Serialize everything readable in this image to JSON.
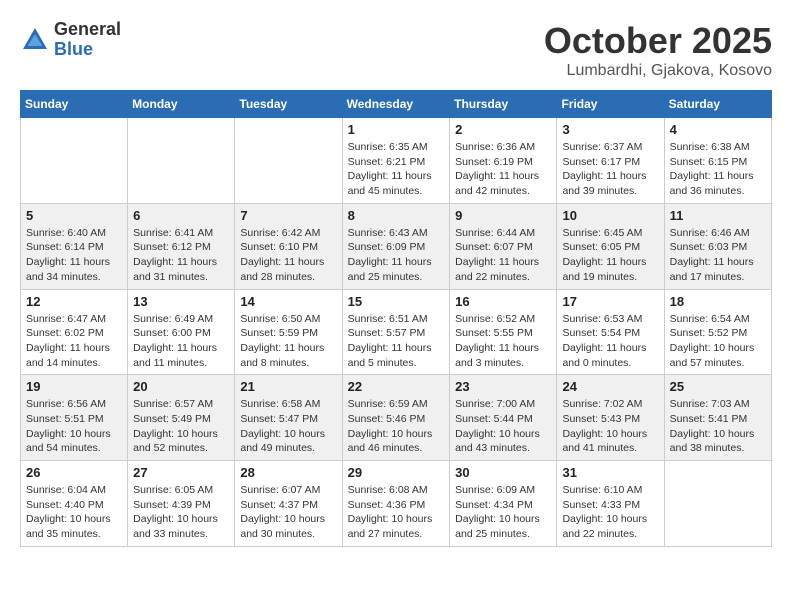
{
  "header": {
    "logo_general": "General",
    "logo_blue": "Blue",
    "month": "October 2025",
    "location": "Lumbardhi, Gjakova, Kosovo"
  },
  "weekdays": [
    "Sunday",
    "Monday",
    "Tuesday",
    "Wednesday",
    "Thursday",
    "Friday",
    "Saturday"
  ],
  "weeks": [
    [
      {
        "day": "",
        "info": ""
      },
      {
        "day": "",
        "info": ""
      },
      {
        "day": "",
        "info": ""
      },
      {
        "day": "1",
        "info": "Sunrise: 6:35 AM\nSunset: 6:21 PM\nDaylight: 11 hours and 45 minutes."
      },
      {
        "day": "2",
        "info": "Sunrise: 6:36 AM\nSunset: 6:19 PM\nDaylight: 11 hours and 42 minutes."
      },
      {
        "day": "3",
        "info": "Sunrise: 6:37 AM\nSunset: 6:17 PM\nDaylight: 11 hours and 39 minutes."
      },
      {
        "day": "4",
        "info": "Sunrise: 6:38 AM\nSunset: 6:15 PM\nDaylight: 11 hours and 36 minutes."
      }
    ],
    [
      {
        "day": "5",
        "info": "Sunrise: 6:40 AM\nSunset: 6:14 PM\nDaylight: 11 hours and 34 minutes."
      },
      {
        "day": "6",
        "info": "Sunrise: 6:41 AM\nSunset: 6:12 PM\nDaylight: 11 hours and 31 minutes."
      },
      {
        "day": "7",
        "info": "Sunrise: 6:42 AM\nSunset: 6:10 PM\nDaylight: 11 hours and 28 minutes."
      },
      {
        "day": "8",
        "info": "Sunrise: 6:43 AM\nSunset: 6:09 PM\nDaylight: 11 hours and 25 minutes."
      },
      {
        "day": "9",
        "info": "Sunrise: 6:44 AM\nSunset: 6:07 PM\nDaylight: 11 hours and 22 minutes."
      },
      {
        "day": "10",
        "info": "Sunrise: 6:45 AM\nSunset: 6:05 PM\nDaylight: 11 hours and 19 minutes."
      },
      {
        "day": "11",
        "info": "Sunrise: 6:46 AM\nSunset: 6:03 PM\nDaylight: 11 hours and 17 minutes."
      }
    ],
    [
      {
        "day": "12",
        "info": "Sunrise: 6:47 AM\nSunset: 6:02 PM\nDaylight: 11 hours and 14 minutes."
      },
      {
        "day": "13",
        "info": "Sunrise: 6:49 AM\nSunset: 6:00 PM\nDaylight: 11 hours and 11 minutes."
      },
      {
        "day": "14",
        "info": "Sunrise: 6:50 AM\nSunset: 5:59 PM\nDaylight: 11 hours and 8 minutes."
      },
      {
        "day": "15",
        "info": "Sunrise: 6:51 AM\nSunset: 5:57 PM\nDaylight: 11 hours and 5 minutes."
      },
      {
        "day": "16",
        "info": "Sunrise: 6:52 AM\nSunset: 5:55 PM\nDaylight: 11 hours and 3 minutes."
      },
      {
        "day": "17",
        "info": "Sunrise: 6:53 AM\nSunset: 5:54 PM\nDaylight: 11 hours and 0 minutes."
      },
      {
        "day": "18",
        "info": "Sunrise: 6:54 AM\nSunset: 5:52 PM\nDaylight: 10 hours and 57 minutes."
      }
    ],
    [
      {
        "day": "19",
        "info": "Sunrise: 6:56 AM\nSunset: 5:51 PM\nDaylight: 10 hours and 54 minutes."
      },
      {
        "day": "20",
        "info": "Sunrise: 6:57 AM\nSunset: 5:49 PM\nDaylight: 10 hours and 52 minutes."
      },
      {
        "day": "21",
        "info": "Sunrise: 6:58 AM\nSunset: 5:47 PM\nDaylight: 10 hours and 49 minutes."
      },
      {
        "day": "22",
        "info": "Sunrise: 6:59 AM\nSunset: 5:46 PM\nDaylight: 10 hours and 46 minutes."
      },
      {
        "day": "23",
        "info": "Sunrise: 7:00 AM\nSunset: 5:44 PM\nDaylight: 10 hours and 43 minutes."
      },
      {
        "day": "24",
        "info": "Sunrise: 7:02 AM\nSunset: 5:43 PM\nDaylight: 10 hours and 41 minutes."
      },
      {
        "day": "25",
        "info": "Sunrise: 7:03 AM\nSunset: 5:41 PM\nDaylight: 10 hours and 38 minutes."
      }
    ],
    [
      {
        "day": "26",
        "info": "Sunrise: 6:04 AM\nSunset: 4:40 PM\nDaylight: 10 hours and 35 minutes."
      },
      {
        "day": "27",
        "info": "Sunrise: 6:05 AM\nSunset: 4:39 PM\nDaylight: 10 hours and 33 minutes."
      },
      {
        "day": "28",
        "info": "Sunrise: 6:07 AM\nSunset: 4:37 PM\nDaylight: 10 hours and 30 minutes."
      },
      {
        "day": "29",
        "info": "Sunrise: 6:08 AM\nSunset: 4:36 PM\nDaylight: 10 hours and 27 minutes."
      },
      {
        "day": "30",
        "info": "Sunrise: 6:09 AM\nSunset: 4:34 PM\nDaylight: 10 hours and 25 minutes."
      },
      {
        "day": "31",
        "info": "Sunrise: 6:10 AM\nSunset: 4:33 PM\nDaylight: 10 hours and 22 minutes."
      },
      {
        "day": "",
        "info": ""
      }
    ]
  ]
}
